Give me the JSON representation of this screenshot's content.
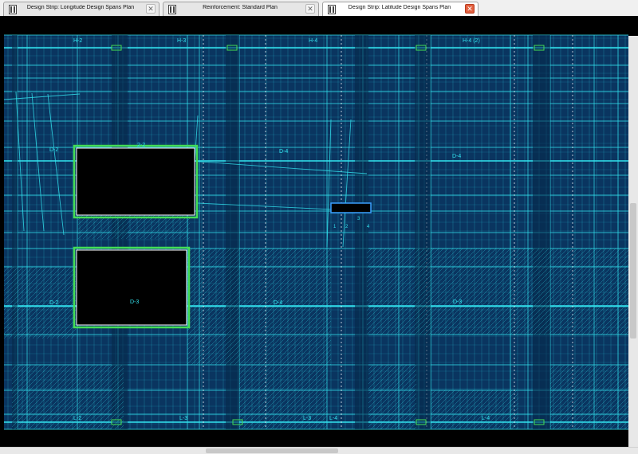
{
  "tabs": [
    {
      "label": "Design Strip: Longitude Design Spans Plan",
      "active": false
    },
    {
      "label": "Reinforcement: Standard Plan",
      "active": false
    },
    {
      "label": "Design Strip: Latitude Design Spans Plan",
      "active": true
    }
  ],
  "plan": {
    "background_color": "#0a3560",
    "line_color": "#33e5f0",
    "opening_highlight_color": "#44dd55",
    "opening_fill_color": "#000000",
    "top_strip_labels": [
      "H-2",
      "H-3",
      "H-4",
      "H-4 (2)"
    ],
    "mid_upper_labels": [
      "D-2",
      "2-2",
      "D-4",
      "D-4"
    ],
    "mid_lower_labels": [
      "D-2",
      "D-3",
      "D-4",
      "D-3"
    ],
    "bottom_strip_labels": [
      "L-2",
      "L-3",
      "L-3",
      "L-4",
      "L-4"
    ],
    "opening_small_labels": [
      "1",
      "2",
      "3",
      "4"
    ]
  },
  "scrollbars": {
    "horizontal": true,
    "vertical": true
  }
}
